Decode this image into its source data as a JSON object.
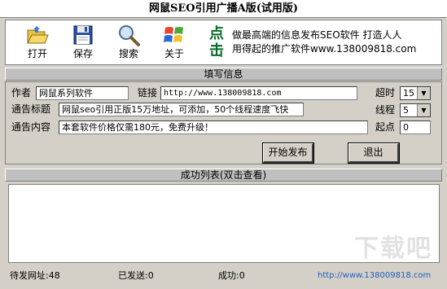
{
  "window": {
    "title": "网鼠SEO引用广播A版(试用版)"
  },
  "toolbar": {
    "open": "打开",
    "save": "保存",
    "search": "搜索",
    "about": "关于"
  },
  "promo": {
    "big_chars": [
      "点",
      "击"
    ],
    "line1": "做最高端的信息发布SEO软件  打造人人",
    "line2": "用得起的推广软件www.138009818.com"
  },
  "form": {
    "section_title": "填写信息",
    "author_label": "作者",
    "author_value": "网鼠系列软件",
    "link_label": "链接",
    "link_value": "http://www.138009818.com",
    "timeout_label": "超时",
    "timeout_value": "15",
    "subject_label": "通告标题",
    "subject_value": "网鼠seo引用正版15万地址，可添加，50个线程速度飞快",
    "threads_label": "线程",
    "threads_value": "5",
    "content_label": "通告内容",
    "content_value": "本套软件价格仅需180元，免费升级！",
    "start_label": "起点",
    "start_value": "0",
    "publish_button": "开始发布",
    "exit_button": "退出"
  },
  "list": {
    "section_title": "成功列表(双击查看)",
    "watermark": "下载吧"
  },
  "status": {
    "pending": "待发网址:48",
    "sent": "已发送:0",
    "success": "成功:0",
    "url": "http://www.138009818.com"
  },
  "colors": {
    "window_bg": "#d4d0c8",
    "promo_green": "#0a6a2a",
    "status_link": "#1f5fbf"
  }
}
